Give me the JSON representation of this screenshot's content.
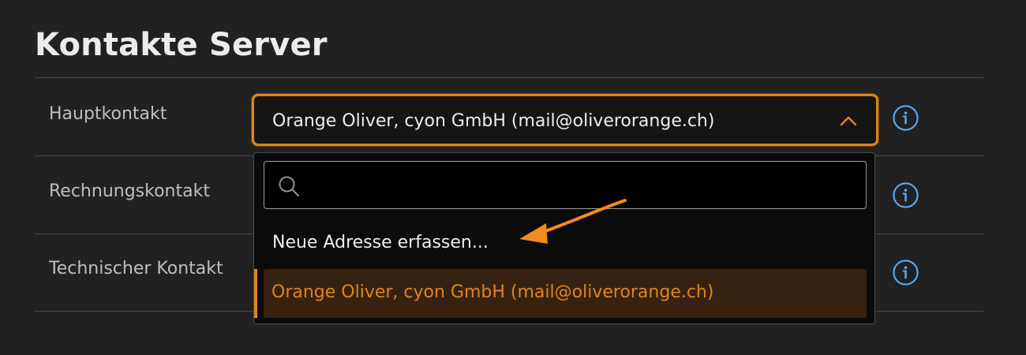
{
  "section": {
    "title": "Kontakte Server"
  },
  "rows": [
    {
      "label": "Hauptkontakt"
    },
    {
      "label": "Rechnungskontakt"
    },
    {
      "label": "Technischer Kontakt"
    }
  ],
  "select": {
    "value": "Orange Oliver, cyon GmbH (mail@oliverorange.ch)",
    "open": true,
    "chevron_icon": "chevron-up-icon"
  },
  "dropdown": {
    "search": {
      "placeholder": "",
      "value": "",
      "icon": "search-icon"
    },
    "new_address_label": "Neue Adresse erfassen...",
    "options": [
      {
        "label": "Orange Oliver, cyon GmbH (mail@oliverorange.ch)",
        "selected": true
      }
    ]
  },
  "info_icon": "info-icon",
  "annotation": {
    "icon": "arrow-icon",
    "color": "#f58a1f"
  },
  "colors": {
    "background": "#212122",
    "accent": "#e0841c",
    "info_blue": "#5aa9f0",
    "selected_option_bg": "#372212"
  }
}
